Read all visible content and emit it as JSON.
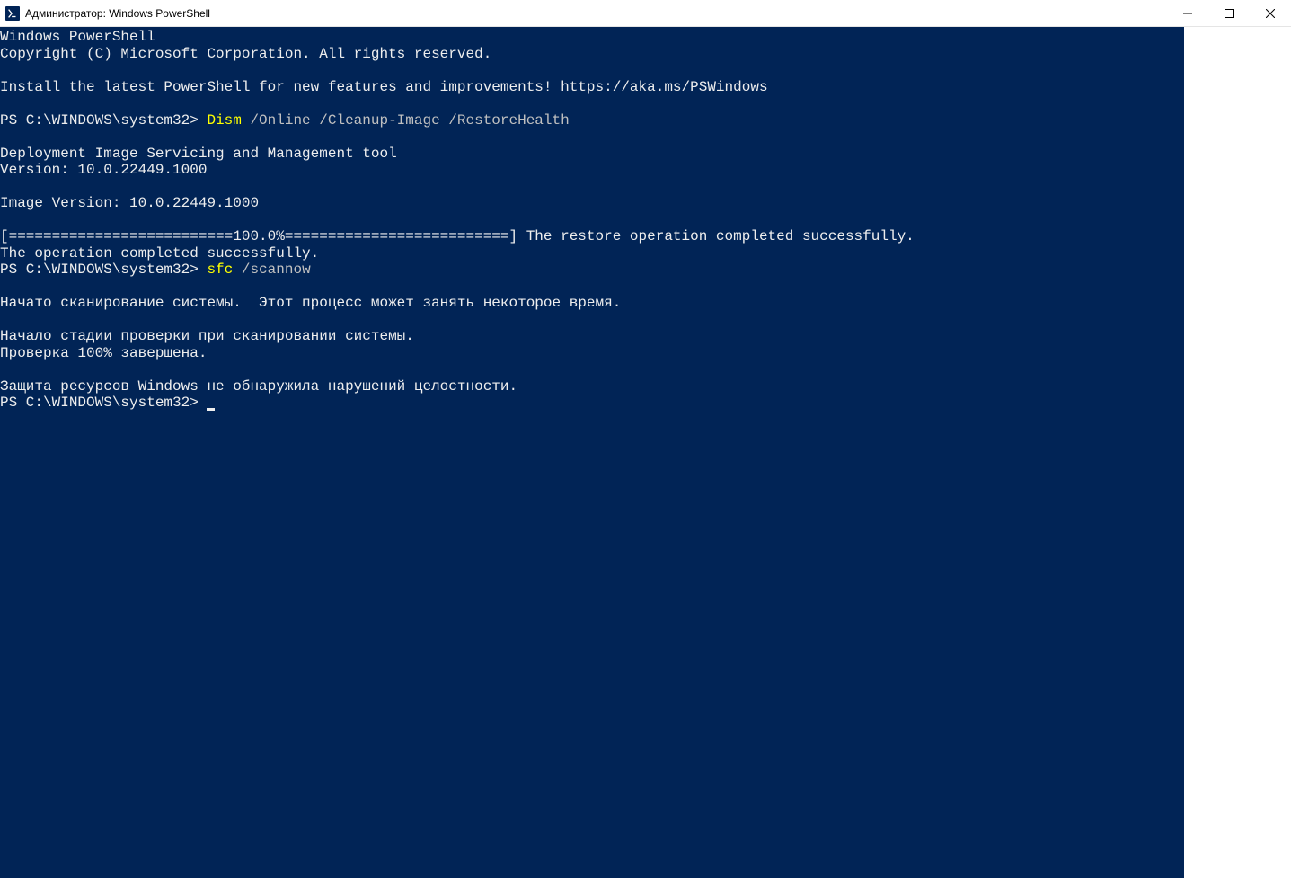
{
  "window": {
    "title": "Администратор: Windows PowerShell"
  },
  "terminal": {
    "lines": {
      "l1": "Windows PowerShell",
      "l2": "Copyright (C) Microsoft Corporation. All rights reserved.",
      "l3": "",
      "l4": "Install the latest PowerShell for new features and improvements! https://aka.ms/PSWindows",
      "l5": "",
      "prompt1_prefix": "PS C:\\WINDOWS\\system32> ",
      "prompt1_cmd": "Dism",
      "prompt1_args": " /Online /Cleanup-Image /RestoreHealth",
      "l6": "",
      "l7": "Deployment Image Servicing and Management tool",
      "l8": "Version: 10.0.22449.1000",
      "l9": "",
      "l10": "Image Version: 10.0.22449.1000",
      "l11": "",
      "l12": "[==========================100.0%==========================] The restore operation completed successfully.",
      "l13": "The operation completed successfully.",
      "prompt2_prefix": "PS C:\\WINDOWS\\system32> ",
      "prompt2_cmd": "sfc",
      "prompt2_args": " /scannow",
      "l14": "",
      "l15": "Начато сканирование системы.  Этот процесс может занять некоторое время.",
      "l16": "",
      "l17": "Начало стадии проверки при сканировании системы.",
      "l18": "Проверка 100% завершена.",
      "l19": "",
      "l20": "Защита ресурсов Windows не обнаружила нарушений целостности.",
      "prompt3_prefix": "PS C:\\WINDOWS\\system32> "
    }
  }
}
